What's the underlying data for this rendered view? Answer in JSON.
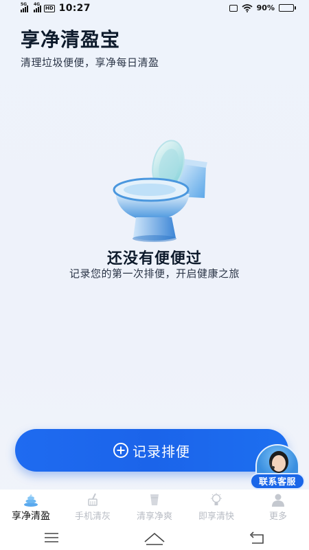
{
  "status_bar": {
    "sim1": "5G",
    "sim2": "4G",
    "hd": "HD",
    "time": "10:27",
    "battery": "90%"
  },
  "header": {
    "title": "享净清盈宝",
    "subtitle": "清理垃圾便便，享净每日清盈"
  },
  "empty_state": {
    "illustration": "toilet-illustration",
    "title": "还没有便便过",
    "subtitle": "记录您的第一次排便，开启健康之旅"
  },
  "record_button": {
    "label": "记录排便",
    "icon": "plus-circle-icon"
  },
  "support": {
    "label": "联系客服",
    "icon": "customer-service-avatar"
  },
  "tabs": [
    {
      "label": "享净清盈",
      "icon": "poop-icon",
      "active": true
    },
    {
      "label": "手机清灰",
      "icon": "brush-icon",
      "active": false
    },
    {
      "label": "清享净爽",
      "icon": "cup-icon",
      "active": false
    },
    {
      "label": "即享清快",
      "icon": "bulb-icon",
      "active": false
    },
    {
      "label": "更多",
      "icon": "user-icon",
      "active": false
    }
  ],
  "nav": [
    "menu-icon",
    "home-icon",
    "back-icon"
  ],
  "colors": {
    "accent": "#1b64ea",
    "background": "#eef2fa",
    "tab_active": "#111111",
    "tab_inactive": "#b8bcc4"
  }
}
